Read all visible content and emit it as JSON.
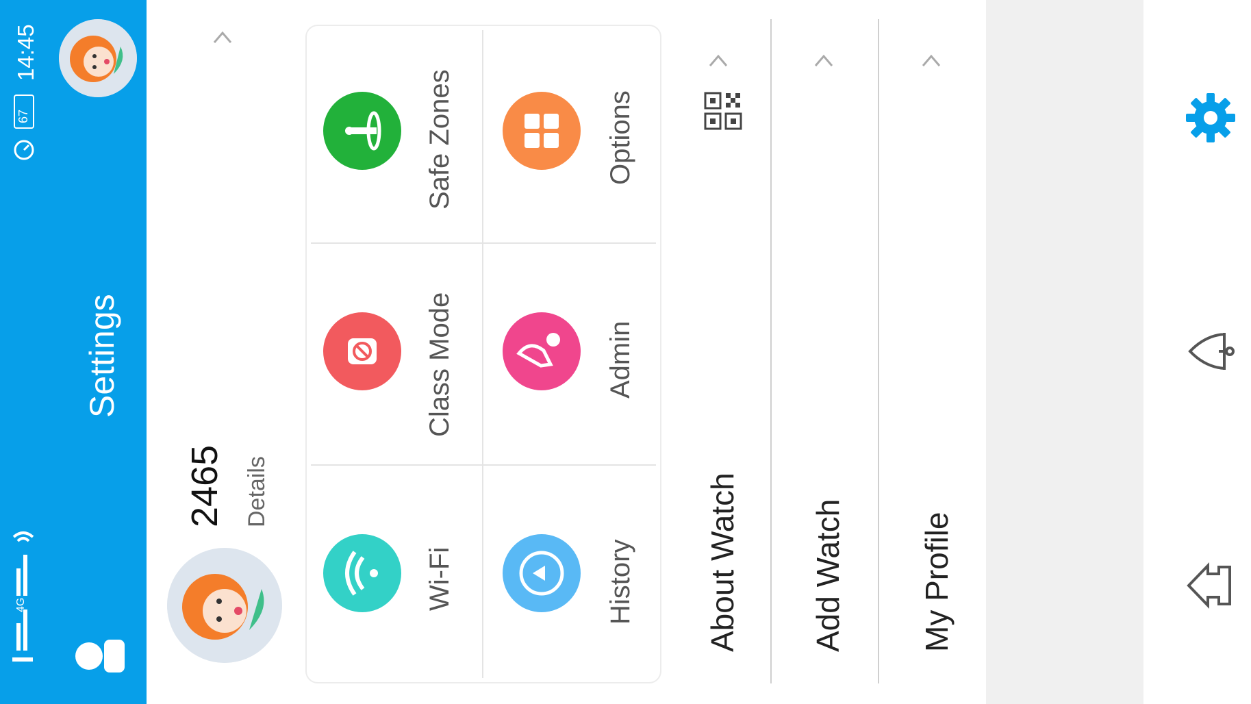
{
  "status_bar": {
    "time": "14:45",
    "battery": "67",
    "network": "4G"
  },
  "header": {
    "title": "Settings"
  },
  "profile": {
    "number": "2465",
    "details_label": "Details"
  },
  "grid": {
    "tiles": [
      {
        "label": "Safe Zones",
        "icon": "safe-zone-icon",
        "color": "#22b13a"
      },
      {
        "label": "Class Mode",
        "icon": "class-mode-icon",
        "color": "#f25a5e"
      },
      {
        "label": "Wi-Fi",
        "icon": "wifi-icon",
        "color": "#33d1c7"
      },
      {
        "label": "Options",
        "icon": "grid-icon",
        "color": "#f98b47"
      },
      {
        "label": "Admin",
        "icon": "admin-icon",
        "color": "#f0468d"
      },
      {
        "label": "History",
        "icon": "history-icon",
        "color": "#59b9f5"
      }
    ]
  },
  "menu": {
    "items": [
      {
        "label": "About Watch",
        "icon": "qr-code-icon"
      },
      {
        "label": "Add Watch"
      },
      {
        "label": "My Profile"
      }
    ]
  },
  "nav": {
    "items": [
      {
        "name": "settings",
        "icon": "gear-icon",
        "color": "#079fe9"
      },
      {
        "name": "notifications",
        "icon": "bell-icon",
        "color": "#555555"
      },
      {
        "name": "home",
        "icon": "home-icon",
        "color": "#555555"
      }
    ]
  },
  "colors": {
    "header": "#079fe9",
    "gray_band": "#f0f0f0"
  }
}
